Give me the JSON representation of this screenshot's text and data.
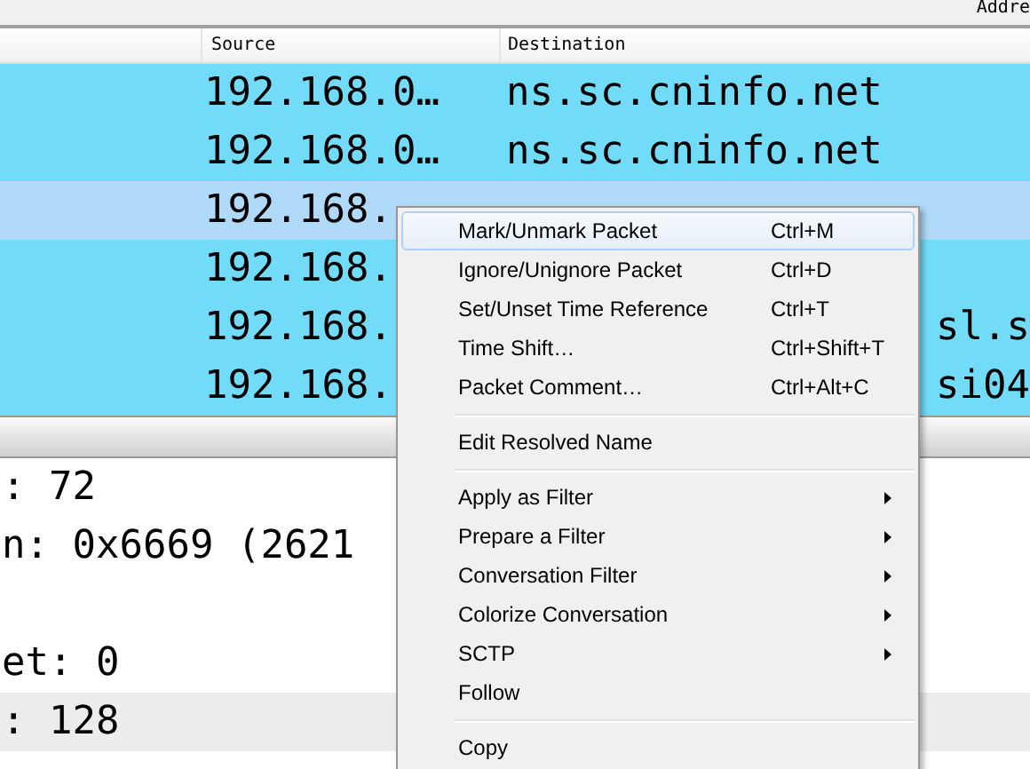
{
  "toolbar": {
    "label": "Addre"
  },
  "packet_list": {
    "columns": [
      "Source",
      "Destination"
    ],
    "rows": [
      {
        "source": "192.168.0…",
        "destination": "ns.sc.cninfo.net",
        "selected": false
      },
      {
        "source": "192.168.0…",
        "destination": "ns.sc.cninfo.net",
        "selected": false
      },
      {
        "source": "192.168.",
        "selected": true
      },
      {
        "source": "192.168.",
        "selected": false
      },
      {
        "source": "192.168.",
        "destination_end": "sl.s",
        "selected": false
      },
      {
        "source": "192.168.",
        "destination_end": "si04",
        "selected": false
      }
    ]
  },
  "details": [
    {
      "text": ": 72",
      "selected": false
    },
    {
      "text": "n: 0x6669 (2621",
      "selected": false
    },
    {
      "text": "et: 0",
      "selected": false
    },
    {
      "text": ": 128",
      "selected": true
    }
  ],
  "context_menu": [
    {
      "kind": "item",
      "label": "Mark/Unmark Packet",
      "shortcut": "Ctrl+M",
      "selected": true
    },
    {
      "kind": "item",
      "label": "Ignore/Unignore Packet",
      "shortcut": "Ctrl+D",
      "selected": false
    },
    {
      "kind": "item",
      "label": "Set/Unset Time Reference",
      "shortcut": "Ctrl+T",
      "selected": false
    },
    {
      "kind": "item",
      "label": "Time Shift…",
      "shortcut": "Ctrl+Shift+T",
      "selected": false
    },
    {
      "kind": "item",
      "label": "Packet Comment…",
      "shortcut": "Ctrl+Alt+C",
      "selected": false
    },
    {
      "kind": "separator"
    },
    {
      "kind": "item",
      "label": "Edit Resolved Name",
      "selected": false
    },
    {
      "kind": "separator"
    },
    {
      "kind": "submenu",
      "label": "Apply as Filter",
      "selected": false
    },
    {
      "kind": "submenu",
      "label": "Prepare a Filter",
      "selected": false
    },
    {
      "kind": "submenu",
      "label": "Conversation Filter",
      "selected": false
    },
    {
      "kind": "submenu",
      "label": "Colorize Conversation",
      "selected": false
    },
    {
      "kind": "submenu",
      "label": "SCTP",
      "selected": false
    },
    {
      "kind": "item",
      "label": "Follow",
      "selected": false
    },
    {
      "kind": "separator"
    },
    {
      "kind": "item",
      "label": "Copy",
      "selected": false
    }
  ]
}
